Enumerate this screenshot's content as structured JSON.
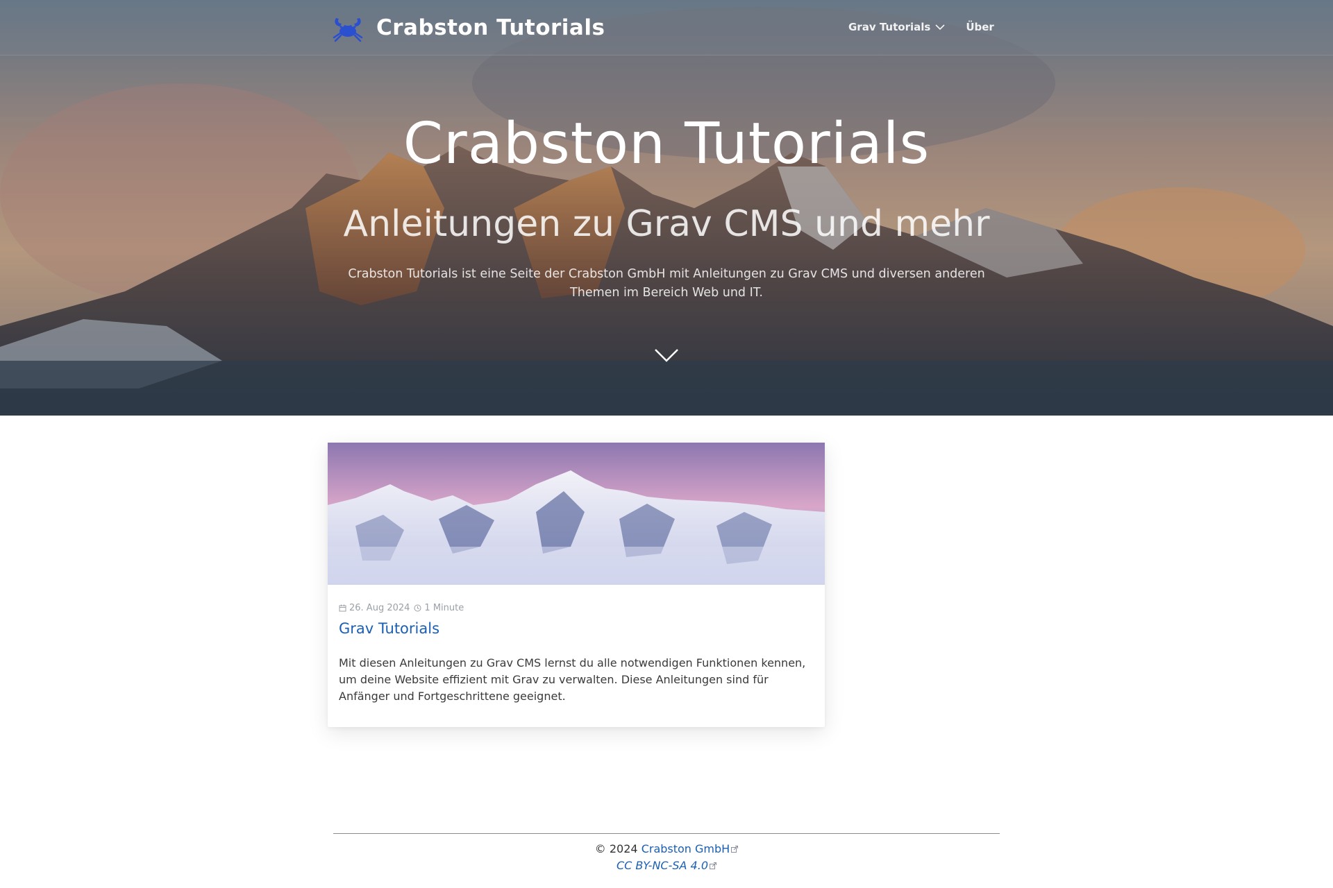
{
  "header": {
    "brand_name": "Crabston Tutorials",
    "nav": [
      {
        "label": "Grav Tutorials",
        "has_dropdown": true
      },
      {
        "label": "Über",
        "has_dropdown": false
      }
    ]
  },
  "hero": {
    "title": "Crabston Tutorials",
    "subtitle": "Anleitungen zu Grav CMS und mehr",
    "description": "Crabston Tutorials ist eine Seite der Crabston GmbH mit Anleitungen zu Grav CMS und diversen anderen Themen im Bereich Web und IT."
  },
  "posts": [
    {
      "date": "26. Aug 2024",
      "reading_time": "1 Minute",
      "title": "Grav Tutorials",
      "summary": "Mit diesen Anleitungen zu Grav CMS lernst du alle notwendigen Funktionen kennen, um deine Website effizient mit Grav zu verwalten. Diese Anleitungen sind für Anfänger und Fortgeschrittene geeignet."
    }
  ],
  "footer": {
    "copyright_prefix": "© 2024",
    "company_link": "Crabston GmbH",
    "license_link": "CC BY-NC-SA 4.0"
  },
  "colors": {
    "link": "#1a5fb4",
    "logo": "#2a4fcf",
    "meta_text": "#9aa0a6"
  },
  "icons": [
    "crab-logo-icon",
    "chevron-down-icon",
    "calendar-icon",
    "clock-icon",
    "external-link-icon"
  ]
}
